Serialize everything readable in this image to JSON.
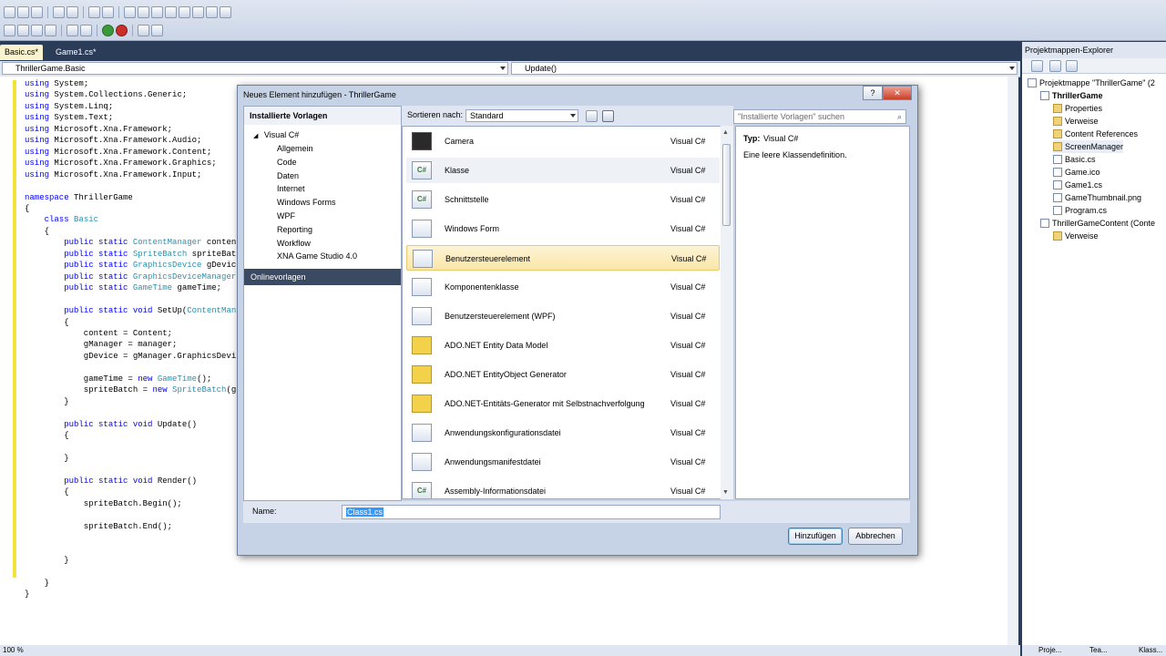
{
  "toolbar": {},
  "editor": {
    "tabs": [
      {
        "label": "Basic.cs*",
        "active": true
      },
      {
        "label": "Game1.cs*",
        "active": false
      }
    ],
    "class_combo": "ThrillerGame.Basic",
    "member_combo": "Update()",
    "zoom": "100 %",
    "code_lines": [
      [
        {
          "t": "using",
          "c": "kw"
        },
        {
          "t": " System;"
        }
      ],
      [
        {
          "t": "using",
          "c": "kw"
        },
        {
          "t": " System.Collections.Generic;"
        }
      ],
      [
        {
          "t": "using",
          "c": "kw"
        },
        {
          "t": " System.Linq;"
        }
      ],
      [
        {
          "t": "using",
          "c": "kw"
        },
        {
          "t": " System.Text;"
        }
      ],
      [
        {
          "t": "using",
          "c": "kw"
        },
        {
          "t": " Microsoft.Xna.Framework;"
        }
      ],
      [
        {
          "t": "using",
          "c": "kw"
        },
        {
          "t": " Microsoft.Xna.Framework.Audio;"
        }
      ],
      [
        {
          "t": "using",
          "c": "kw"
        },
        {
          "t": " Microsoft.Xna.Framework.Content;"
        }
      ],
      [
        {
          "t": "using",
          "c": "kw"
        },
        {
          "t": " Microsoft.Xna.Framework.Graphics;"
        }
      ],
      [
        {
          "t": "using",
          "c": "kw"
        },
        {
          "t": " Microsoft.Xna.Framework.Input;"
        }
      ],
      [],
      [
        {
          "t": "namespace",
          "c": "kw"
        },
        {
          "t": " ThrillerGame"
        }
      ],
      [
        {
          "t": "{"
        }
      ],
      [
        {
          "t": "    "
        },
        {
          "t": "class",
          "c": "kw"
        },
        {
          "t": " "
        },
        {
          "t": "Basic",
          "c": "ty"
        }
      ],
      [
        {
          "t": "    {"
        }
      ],
      [
        {
          "t": "        "
        },
        {
          "t": "public static",
          "c": "kw"
        },
        {
          "t": " "
        },
        {
          "t": "ContentManager",
          "c": "ty"
        },
        {
          "t": " conten"
        }
      ],
      [
        {
          "t": "        "
        },
        {
          "t": "public static",
          "c": "kw"
        },
        {
          "t": " "
        },
        {
          "t": "SpriteBatch",
          "c": "ty"
        },
        {
          "t": " spriteBat"
        }
      ],
      [
        {
          "t": "        "
        },
        {
          "t": "public static",
          "c": "kw"
        },
        {
          "t": " "
        },
        {
          "t": "GraphicsDevice",
          "c": "ty"
        },
        {
          "t": " gDevic"
        }
      ],
      [
        {
          "t": "        "
        },
        {
          "t": "public static",
          "c": "kw"
        },
        {
          "t": " "
        },
        {
          "t": "GraphicsDeviceManager",
          "c": "ty"
        }
      ],
      [
        {
          "t": "        "
        },
        {
          "t": "public static",
          "c": "kw"
        },
        {
          "t": " "
        },
        {
          "t": "GameTime",
          "c": "ty"
        },
        {
          "t": " gameTime;"
        }
      ],
      [],
      [
        {
          "t": "        "
        },
        {
          "t": "public static void",
          "c": "kw"
        },
        {
          "t": " SetUp("
        },
        {
          "t": "ContentMan",
          "c": "ty"
        }
      ],
      [
        {
          "t": "        {"
        }
      ],
      [
        {
          "t": "            content = Content;"
        }
      ],
      [
        {
          "t": "            gManager = manager;"
        }
      ],
      [
        {
          "t": "            gDevice = gManager.GraphicsDevi"
        }
      ],
      [],
      [
        {
          "t": "            gameTime = "
        },
        {
          "t": "new",
          "c": "kw"
        },
        {
          "t": " "
        },
        {
          "t": "GameTime",
          "c": "ty"
        },
        {
          "t": "();"
        }
      ],
      [
        {
          "t": "            spriteBatch = "
        },
        {
          "t": "new",
          "c": "kw"
        },
        {
          "t": " "
        },
        {
          "t": "SpriteBatch",
          "c": "ty"
        },
        {
          "t": "(g"
        }
      ],
      [
        {
          "t": "        }"
        }
      ],
      [],
      [
        {
          "t": "        "
        },
        {
          "t": "public static void",
          "c": "kw"
        },
        {
          "t": " Update()"
        }
      ],
      [
        {
          "t": "        {"
        }
      ],
      [],
      [
        {
          "t": "        }"
        }
      ],
      [],
      [
        {
          "t": "        "
        },
        {
          "t": "public static void",
          "c": "kw"
        },
        {
          "t": " Render()"
        }
      ],
      [
        {
          "t": "        {"
        }
      ],
      [
        {
          "t": "            spriteBatch.Begin();"
        }
      ],
      [],
      [
        {
          "t": "            spriteBatch.End();"
        }
      ],
      [],
      [],
      [
        {
          "t": "        }"
        }
      ],
      [],
      [
        {
          "t": "    }"
        }
      ],
      [
        {
          "t": "}"
        }
      ]
    ]
  },
  "dialog": {
    "title": "Neues Element hinzufügen - ThrillerGame",
    "installed_header": "Installierte Vorlagen",
    "tree": {
      "root": "Visual C#",
      "children": [
        "Allgemein",
        "Code",
        "Daten",
        "Internet",
        "Windows Forms",
        "WPF",
        "Reporting",
        "Workflow",
        "XNA Game Studio 4.0"
      ]
    },
    "online": "Onlinevorlagen",
    "sort_label": "Sortieren nach:",
    "sort_value": "Standard",
    "search_placeholder": "\"Installierte Vorlagen\" suchen",
    "items": [
      {
        "name": "Camera",
        "lang": "Visual C#",
        "icon": "camera-icon"
      },
      {
        "name": "Klasse",
        "lang": "Visual C#",
        "icon": "class-icon"
      },
      {
        "name": "Schnittstelle",
        "lang": "Visual C#",
        "icon": "interface-icon"
      },
      {
        "name": "Windows Form",
        "lang": "Visual C#",
        "icon": "windows-form-icon"
      },
      {
        "name": "Benutzersteuerelement",
        "lang": "Visual C#",
        "icon": "user-control-icon"
      },
      {
        "name": "Komponentenklasse",
        "lang": "Visual C#",
        "icon": "component-class-icon"
      },
      {
        "name": "Benutzersteuerelement (WPF)",
        "lang": "Visual C#",
        "icon": "wpf-user-control-icon"
      },
      {
        "name": "ADO.NET Entity Data Model",
        "lang": "Visual C#",
        "icon": "entity-model-icon"
      },
      {
        "name": "ADO.NET EntityObject Generator",
        "lang": "Visual C#",
        "icon": "entity-generator-icon"
      },
      {
        "name": "ADO.NET-Entitäts-Generator mit Selbstnachverfolgung",
        "lang": "Visual C#",
        "icon": "entity-generator-icon"
      },
      {
        "name": "Anwendungskonfigurationsdatei",
        "lang": "Visual C#",
        "icon": "config-file-icon"
      },
      {
        "name": "Anwendungsmanifestdatei",
        "lang": "Visual C#",
        "icon": "manifest-file-icon"
      },
      {
        "name": "Assembly-Informationsdatei",
        "lang": "Visual C#",
        "icon": "assembly-info-icon"
      }
    ],
    "details": {
      "type_label": "Typ:",
      "type_value": "Visual C#",
      "description": "Eine leere Klassendefinition."
    },
    "name_label": "Name:",
    "name_value": "Class1.cs",
    "add_button": "Hinzufügen",
    "cancel_button": "Abbrechen"
  },
  "explorer": {
    "title": "Projektmappen-Explorer",
    "nodes": [
      {
        "label": "Projektmappe \"ThrillerGame\" (2",
        "indent": 0,
        "icon": "solution-icon"
      },
      {
        "label": "ThrillerGame",
        "indent": 1,
        "icon": "project-icon",
        "bold": true
      },
      {
        "label": "Properties",
        "indent": 2,
        "icon": "properties-icon"
      },
      {
        "label": "Verweise",
        "indent": 2,
        "icon": "references-icon"
      },
      {
        "label": "Content References",
        "indent": 2,
        "icon": "content-references-icon"
      },
      {
        "label": "ScreenManager",
        "indent": 2,
        "icon": "folder-icon"
      },
      {
        "label": "Basic.cs",
        "indent": 2,
        "icon": "cs-file-icon"
      },
      {
        "label": "Game.ico",
        "indent": 2,
        "icon": "ico-file-icon"
      },
      {
        "label": "Game1.cs",
        "indent": 2,
        "icon": "cs-file-icon"
      },
      {
        "label": "GameThumbnail.png",
        "indent": 2,
        "icon": "png-file-icon"
      },
      {
        "label": "Program.cs",
        "indent": 2,
        "icon": "cs-file-icon"
      },
      {
        "label": "ThrillerGameContent (Conte",
        "indent": 1,
        "icon": "content-project-icon"
      },
      {
        "label": "Verweise",
        "indent": 2,
        "icon": "references-icon"
      }
    ],
    "bottom_tabs": [
      "Proje...",
      "Tea...",
      "Klass..."
    ]
  }
}
